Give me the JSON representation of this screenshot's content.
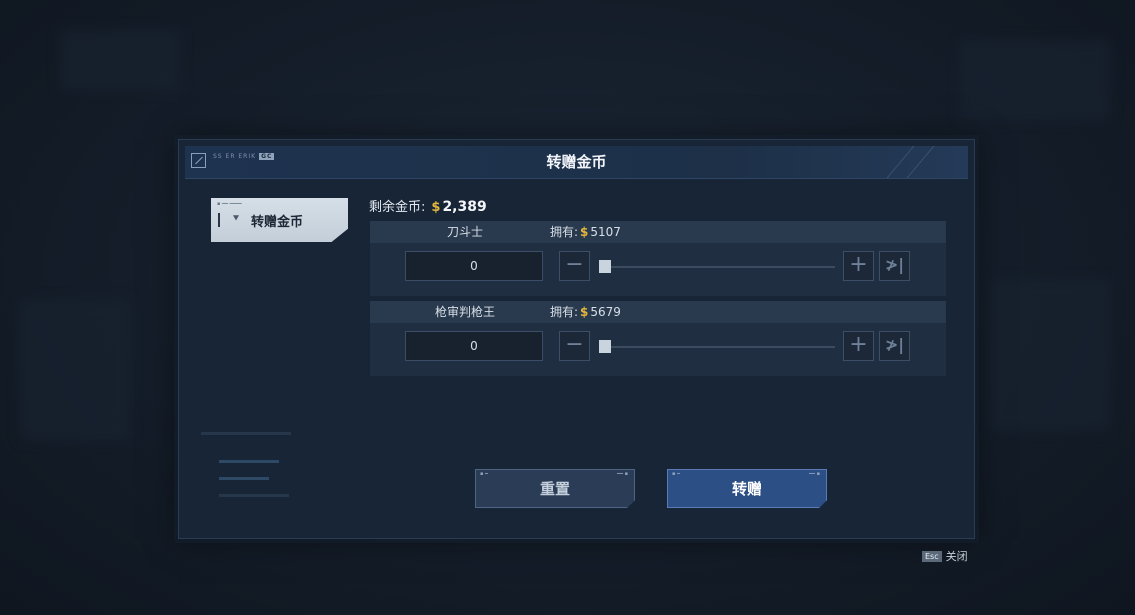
{
  "dialog": {
    "title": "转赠金币",
    "header_code": "SS ER ERIK",
    "header_tag": "GC",
    "side_tab": {
      "label": "转赠金币",
      "icon": "mech-emblem-icon"
    },
    "remaining": {
      "label": "剩余金币:",
      "currency_symbol": "$",
      "amount": "2,389"
    },
    "players": [
      {
        "name": "刀斗士",
        "own_label": "拥有:",
        "currency_symbol": "$",
        "own_amount": "5107",
        "input_value": "0",
        "slider_fraction": 0
      },
      {
        "name": "枪审判枪王",
        "own_label": "拥有:",
        "currency_symbol": "$",
        "own_amount": "5679",
        "input_value": "0",
        "slider_fraction": 0
      }
    ],
    "buttons": {
      "minus": "−",
      "plus": "+",
      "max": "≯|",
      "reset": "重置",
      "gift": "转赠"
    }
  },
  "footer": {
    "esc_key": "Esc",
    "close_label": "关闭"
  },
  "colors": {
    "accent_gold": "#e3b73d",
    "primary_button": "#2c4f86",
    "panel": "#182536"
  }
}
